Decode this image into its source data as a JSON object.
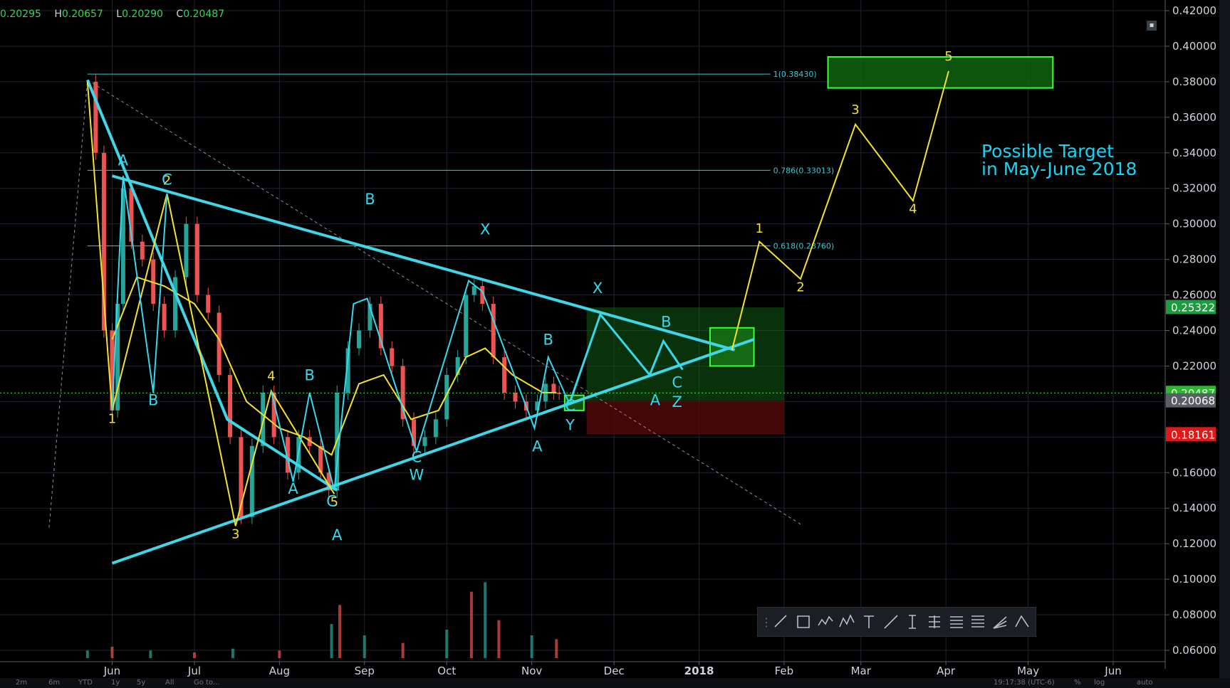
{
  "ohlc": {
    "open_value": "0.20295",
    "high_label": "H",
    "high_value": "0.20657",
    "low_label": "L",
    "low_value": "0.20290",
    "close_label": "C",
    "close_value": "0.20487"
  },
  "target_text": {
    "line1": "Possible Target",
    "line2": "in May-June 2018"
  },
  "toolbar_tools": [
    "pencil-icon",
    "rectangle-icon",
    "zigzag-icon",
    "wave-abc-icon",
    "text-icon",
    "trend-line-icon",
    "price-range-icon",
    "pitchfork-icon",
    "gann-icon",
    "fib-levels-icon",
    "fan-icon",
    "triangle-pattern-icon"
  ],
  "bottom_bar": [
    "2m",
    "6m",
    "YTD",
    "1y",
    "5y",
    "All",
    "Go to...",
    "19:17:38 (UTC-6)",
    "%",
    "log",
    "auto"
  ],
  "colors": {
    "background": "#000000",
    "grid": "#1f2330",
    "candle_up": "#26a69a",
    "candle_down": "#ef5350",
    "trend_line": "#3fd7e8",
    "wave_yellow": "#f5e12e",
    "wave_cyan": "#37d8ec",
    "fib_line": "#3fc6d6",
    "zone_green": "#0f6b14",
    "zone_red": "#4a0a0a",
    "price_tag_green": "#2db82d",
    "price_tag_red": "#e01818",
    "ma_fast": "#f5e12e",
    "ma_slow": "#3fd7e8"
  },
  "chart_data": {
    "type": "line",
    "x_axis": {
      "labels": [
        "Jun",
        "Jul",
        "Aug",
        "Sep",
        "Oct",
        "Nov",
        "Dec",
        "2018",
        "Feb",
        "Mar",
        "Apr",
        "May",
        "Jun"
      ],
      "dates": [
        "2017-06-01",
        "2017-07-01",
        "2017-08-01",
        "2017-09-01",
        "2017-10-01",
        "2017-11-01",
        "2017-12-01",
        "2018-01-01",
        "2018-02-01",
        "2018-03-01",
        "2018-04-01",
        "2018-05-01",
        "2018-06-01"
      ]
    },
    "y_axis": {
      "ylim": [
        0.055,
        0.42
      ],
      "ticks": [
        "0.42000",
        "0.40000",
        "0.38000",
        "0.36000",
        "0.34000",
        "0.32000",
        "0.30000",
        "0.28000",
        "0.26000",
        "0.24000",
        "0.22000",
        "0.20000",
        "0.18000",
        "0.16000",
        "0.14000",
        "0.12000",
        "0.10000",
        "0.08000",
        "0.06000"
      ],
      "tick_values": [
        0.42,
        0.4,
        0.38,
        0.36,
        0.34,
        0.32,
        0.3,
        0.28,
        0.26,
        0.24,
        0.22,
        0.2,
        0.18,
        0.16,
        0.14,
        0.12,
        0.1,
        0.08,
        0.06
      ]
    },
    "price_tags": [
      {
        "text": "0.25322",
        "value": 0.25322,
        "color": "#1f9a3f"
      },
      {
        "text": "0.20487",
        "value": 0.20487,
        "color": "#2db82d"
      },
      {
        "text": "0.20068",
        "value": 0.20068,
        "color": "#5a5e66"
      },
      {
        "text": "0.18161",
        "value": 0.18161,
        "color": "#e01818"
      }
    ],
    "current_price": 0.20487,
    "fib_levels": [
      {
        "label": "1(0.38430)",
        "value": 0.3843,
        "x_start": "2017-05-23",
        "x_end": "2018-01-27"
      },
      {
        "label": "0.786(0.33013)",
        "value": 0.33013,
        "x_start": "2017-05-23",
        "x_end": "2018-01-27"
      },
      {
        "label": "0.618(0.28760)",
        "value": 0.2876,
        "x_start": "2017-05-23",
        "x_end": "2018-01-27"
      }
    ],
    "close_series": [
      [
        "2017-05-23",
        0.38
      ],
      [
        "2017-05-26",
        0.34
      ],
      [
        "2017-05-29",
        0.24
      ],
      [
        "2017-06-01",
        0.195
      ],
      [
        "2017-06-03",
        0.255
      ],
      [
        "2017-06-05",
        0.32
      ],
      [
        "2017-06-08",
        0.29
      ],
      [
        "2017-06-12",
        0.28
      ],
      [
        "2017-06-16",
        0.255
      ],
      [
        "2017-06-20",
        0.24
      ],
      [
        "2017-06-24",
        0.27
      ],
      [
        "2017-06-28",
        0.3
      ],
      [
        "2017-07-02",
        0.26
      ],
      [
        "2017-07-06",
        0.25
      ],
      [
        "2017-07-10",
        0.215
      ],
      [
        "2017-07-14",
        0.18
      ],
      [
        "2017-07-18",
        0.135
      ],
      [
        "2017-07-22",
        0.175
      ],
      [
        "2017-07-26",
        0.205
      ],
      [
        "2017-07-30",
        0.18
      ],
      [
        "2017-08-04",
        0.16
      ],
      [
        "2017-08-08",
        0.18
      ],
      [
        "2017-08-12",
        0.175
      ],
      [
        "2017-08-16",
        0.16
      ],
      [
        "2017-08-19",
        0.15
      ],
      [
        "2017-08-22",
        0.205
      ],
      [
        "2017-08-26",
        0.23
      ],
      [
        "2017-08-30",
        0.24
      ],
      [
        "2017-09-03",
        0.255
      ],
      [
        "2017-09-07",
        0.23
      ],
      [
        "2017-09-11",
        0.22
      ],
      [
        "2017-09-15",
        0.19
      ],
      [
        "2017-09-19",
        0.175
      ],
      [
        "2017-09-23",
        0.18
      ],
      [
        "2017-09-27",
        0.19
      ],
      [
        "2017-10-01",
        0.215
      ],
      [
        "2017-10-05",
        0.225
      ],
      [
        "2017-10-08",
        0.26
      ],
      [
        "2017-10-11",
        0.265
      ],
      [
        "2017-10-14",
        0.255
      ],
      [
        "2017-10-18",
        0.225
      ],
      [
        "2017-10-22",
        0.205
      ],
      [
        "2017-10-26",
        0.2
      ],
      [
        "2017-10-30",
        0.195
      ],
      [
        "2017-11-03",
        0.2
      ],
      [
        "2017-11-06",
        0.21
      ],
      [
        "2017-11-09",
        0.205
      ],
      [
        "2017-11-11",
        0.2049
      ]
    ],
    "wave_yellow_main": [
      [
        "2017-05-23",
        0.38
      ],
      [
        "2017-06-01",
        0.195
      ],
      [
        "2017-06-21",
        0.317
      ],
      [
        "2017-07-16",
        0.13
      ],
      [
        "2017-07-29",
        0.206
      ],
      [
        "2017-08-21",
        0.148
      ]
    ],
    "wave_yellow_labels": [
      {
        "text": "1",
        "date": "2017-06-01",
        "value": 0.188,
        "pos": "below"
      },
      {
        "text": "2",
        "date": "2017-06-21",
        "value": 0.322,
        "pos": "above"
      },
      {
        "text": "3",
        "date": "2017-07-16",
        "value": 0.123,
        "pos": "below"
      },
      {
        "text": "4",
        "date": "2017-07-29",
        "value": 0.212,
        "pos": "above"
      },
      {
        "text": "5",
        "date": "2017-08-21",
        "value": 0.141,
        "pos": "below"
      }
    ],
    "wave_yellow_projection": [
      [
        "2018-01-13",
        0.229
      ],
      [
        "2018-01-23",
        0.29
      ],
      [
        "2018-02-07",
        0.269
      ],
      [
        "2018-02-27",
        0.356
      ],
      [
        "2018-03-20",
        0.313
      ],
      [
        "2018-04-02",
        0.386
      ]
    ],
    "wave_yellow_projection_labels": [
      {
        "text": "1",
        "date": "2018-01-23",
        "value": 0.295
      },
      {
        "text": "2",
        "date": "2018-02-07",
        "value": 0.262
      },
      {
        "text": "3",
        "date": "2018-02-27",
        "value": 0.362
      },
      {
        "text": "4",
        "date": "2018-03-20",
        "value": 0.306
      },
      {
        "text": "5",
        "date": "2018-04-02",
        "value": 0.392
      }
    ],
    "wave_cyan_main": [
      [
        "2017-06-01",
        0.195
      ],
      [
        "2017-06-05",
        0.327
      ],
      [
        "2017-06-16",
        0.205
      ],
      [
        "2017-06-21",
        0.317
      ]
    ],
    "wave_cyan_small": [
      [
        "2017-07-29",
        0.206
      ],
      [
        "2017-08-06",
        0.155
      ],
      [
        "2017-08-12",
        0.205
      ],
      [
        "2017-08-21",
        0.15
      ],
      [
        "2017-08-28",
        0.255
      ],
      [
        "2017-09-02",
        0.258
      ],
      [
        "2017-09-20",
        0.172
      ],
      [
        "2017-10-09",
        0.268
      ],
      [
        "2017-10-14",
        0.262
      ],
      [
        "2017-11-02",
        0.185
      ],
      [
        "2017-11-07",
        0.225
      ],
      [
        "2017-11-15",
        0.198
      ]
    ],
    "wave_cyan_projection": [
      [
        "2017-11-15",
        0.2
      ],
      [
        "2017-11-26",
        0.249
      ],
      [
        "2017-12-14",
        0.215
      ],
      [
        "2017-12-19",
        0.234
      ],
      [
        "2017-12-26",
        0.218
      ]
    ],
    "wave_cyan_labels": [
      {
        "text": "A",
        "date": "2017-06-05",
        "value": 0.333
      },
      {
        "text": "B",
        "date": "2017-06-16",
        "value": 0.198
      },
      {
        "text": "C",
        "date": "2017-06-21",
        "value": 0.322
      },
      {
        "text": "A",
        "date": "2017-08-06",
        "value": 0.148
      },
      {
        "text": "B",
        "date": "2017-08-12",
        "value": 0.212
      },
      {
        "text": "C",
        "date": "2017-08-20",
        "value": 0.141
      },
      {
        "text": "A",
        "date": "2017-08-22",
        "value": 0.122
      },
      {
        "text": "B",
        "date": "2017-09-03",
        "value": 0.311
      },
      {
        "text": "C",
        "date": "2017-09-20",
        "value": 0.166
      },
      {
        "text": "W",
        "date": "2017-09-20",
        "value": 0.156
      },
      {
        "text": "X",
        "date": "2017-10-15",
        "value": 0.294
      },
      {
        "text": "A",
        "date": "2017-11-03",
        "value": 0.172
      },
      {
        "text": "B",
        "date": "2017-11-07",
        "value": 0.232
      },
      {
        "text": "C",
        "date": "2017-11-15",
        "value": 0.195
      },
      {
        "text": "Y",
        "date": "2017-11-15",
        "value": 0.184
      },
      {
        "text": "X",
        "date": "2017-11-25",
        "value": 0.261
      },
      {
        "text": "B",
        "date": "2017-12-20",
        "value": 0.242
      },
      {
        "text": "A",
        "date": "2017-12-16",
        "value": 0.198
      },
      {
        "text": "C",
        "date": "2017-12-24",
        "value": 0.208
      },
      {
        "text": "Z",
        "date": "2017-12-24",
        "value": 0.197
      }
    ],
    "triangle_upper": [
      [
        "2017-06-01",
        0.327
      ],
      [
        "2018-01-14",
        0.229
      ]
    ],
    "triangle_lower": [
      [
        "2017-06-01",
        0.109
      ],
      [
        "2018-01-21",
        0.235
      ]
    ],
    "descending_line": [
      [
        "2017-05-23",
        0.381
      ],
      [
        "2017-07-13",
        0.19
      ],
      [
        "2017-08-22",
        0.15
      ]
    ],
    "dashed_diagonal": [
      [
        "2017-05-23",
        0.381
      ],
      [
        "2018-02-07",
        0.131
      ]
    ],
    "dashed_left": [
      [
        "2017-05-09",
        0.129
      ],
      [
        "2017-05-23",
        0.381
      ]
    ],
    "zones": [
      {
        "kind": "green",
        "x0": "2017-11-21",
        "x1": "2018-02-01",
        "y0": 0.2005,
        "y1": 0.253
      },
      {
        "kind": "red",
        "x0": "2017-11-21",
        "x1": "2018-02-01",
        "y0": 0.1815,
        "y1": 0.2005
      },
      {
        "kind": "green-box",
        "x0": "2018-01-05",
        "x1": "2018-01-21",
        "y0": 0.22,
        "y1": 0.2415
      },
      {
        "kind": "green-box-small",
        "x0": "2017-11-13",
        "x1": "2017-11-20",
        "y0": 0.195,
        "y1": 0.2035
      },
      {
        "kind": "green-target",
        "x0": "2018-02-17",
        "x1": "2018-05-10",
        "y0": 0.3765,
        "y1": 0.394
      }
    ],
    "ma_fast": [
      [
        "2017-06-01",
        0.235
      ],
      [
        "2017-06-10",
        0.27
      ],
      [
        "2017-06-20",
        0.265
      ],
      [
        "2017-07-01",
        0.255
      ],
      [
        "2017-07-10",
        0.235
      ],
      [
        "2017-07-20",
        0.2
      ],
      [
        "2017-08-01",
        0.185
      ],
      [
        "2017-08-10",
        0.18
      ],
      [
        "2017-08-20",
        0.17
      ],
      [
        "2017-08-30",
        0.21
      ],
      [
        "2017-09-08",
        0.215
      ],
      [
        "2017-09-18",
        0.19
      ],
      [
        "2017-09-28",
        0.195
      ],
      [
        "2017-10-08",
        0.225
      ],
      [
        "2017-10-15",
        0.23
      ],
      [
        "2017-10-25",
        0.215
      ],
      [
        "2017-11-05",
        0.205
      ],
      [
        "2017-11-10",
        0.205
      ]
    ],
    "volume": [
      [
        "2017-05-23",
        0.004
      ],
      [
        "2017-06-01",
        0.006
      ],
      [
        "2017-06-15",
        0.004
      ],
      [
        "2017-07-01",
        0.003
      ],
      [
        "2017-07-15",
        0.005
      ],
      [
        "2017-08-01",
        0.004
      ],
      [
        "2017-08-20",
        0.018
      ],
      [
        "2017-08-23",
        0.028
      ],
      [
        "2017-09-01",
        0.012
      ],
      [
        "2017-09-15",
        0.008
      ],
      [
        "2017-10-01",
        0.015
      ],
      [
        "2017-10-10",
        0.035
      ],
      [
        "2017-10-15",
        0.04
      ],
      [
        "2017-10-20",
        0.02
      ],
      [
        "2017-11-01",
        0.012
      ],
      [
        "2017-11-10",
        0.01
      ]
    ],
    "volume_scale_max": 0.09
  }
}
